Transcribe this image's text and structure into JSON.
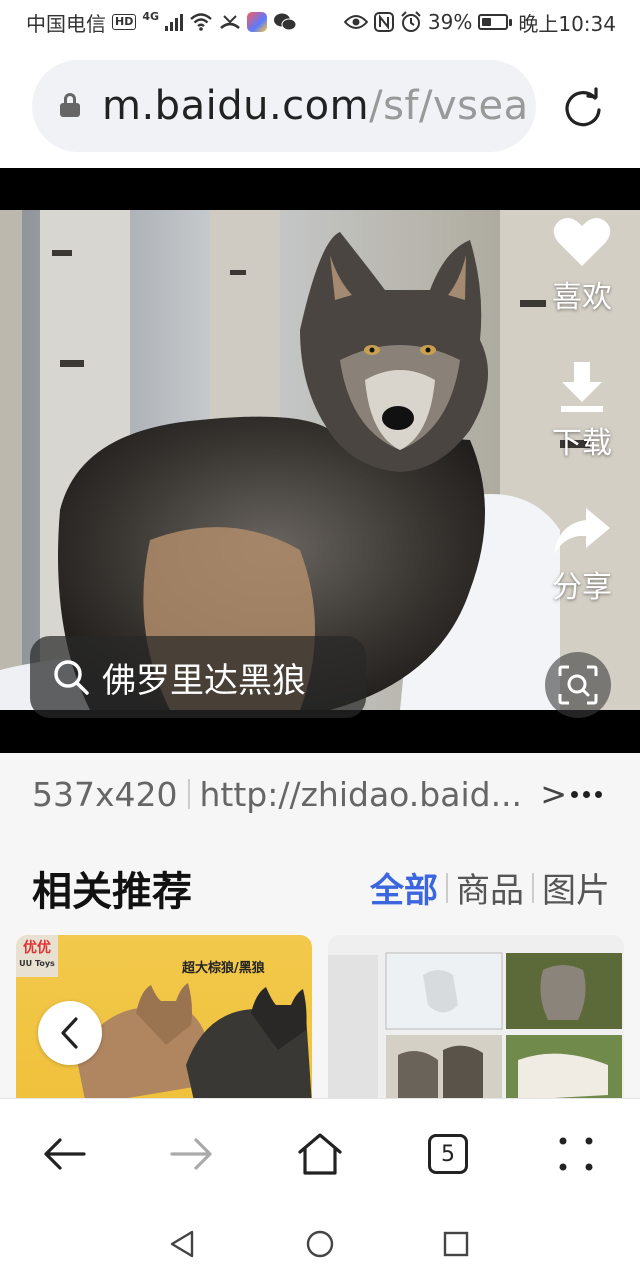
{
  "status_bar": {
    "carrier": "中国电信",
    "hd_badge": "HD",
    "network_type": "4G",
    "battery": "39%",
    "time": "晚上10:34",
    "icons": [
      "signal-icon",
      "wifi-icon",
      "missed-call-icon",
      "app-notification-icon",
      "wechat-icon",
      "eye-icon",
      "nfc-icon",
      "alarm-icon",
      "battery-icon"
    ]
  },
  "url_bar": {
    "host": "m.baidu.com",
    "path": "/sf/vsea",
    "icons": [
      "lock-icon",
      "reload-icon"
    ]
  },
  "viewer": {
    "actions": [
      {
        "label": "喜欢",
        "icon": "heart-icon"
      },
      {
        "label": "下载",
        "icon": "download-icon"
      },
      {
        "label": "分享",
        "icon": "share-icon"
      }
    ],
    "search_query": "佛罗里达黑狼",
    "lens_icon": "image-search-icon"
  },
  "info": {
    "dimensions": "537x420",
    "source_url": "http://zhidao.baid..."
  },
  "related": {
    "title": "相关推荐",
    "tabs": [
      {
        "label": "全部",
        "active": true
      },
      {
        "label": "商品",
        "active": false
      },
      {
        "label": "图片",
        "active": false
      }
    ],
    "cards": [
      {
        "logo": "优优",
        "logo_sub": "UU Toys",
        "caption": "超大棕狼/黑狼"
      },
      {
        "caption": ""
      }
    ]
  },
  "toolbar": {
    "tab_count": "5",
    "icons": [
      "back-arrow-icon",
      "forward-arrow-icon",
      "home-icon",
      "tabs-icon",
      "menu-icon"
    ]
  },
  "navbar": {
    "icons": [
      "nav-back-icon",
      "nav-home-icon",
      "nav-recents-icon"
    ]
  },
  "colors": {
    "accent": "#3b66e0",
    "url_bar_bg": "#f1f2f5",
    "section_bg": "#f6f6f6"
  }
}
